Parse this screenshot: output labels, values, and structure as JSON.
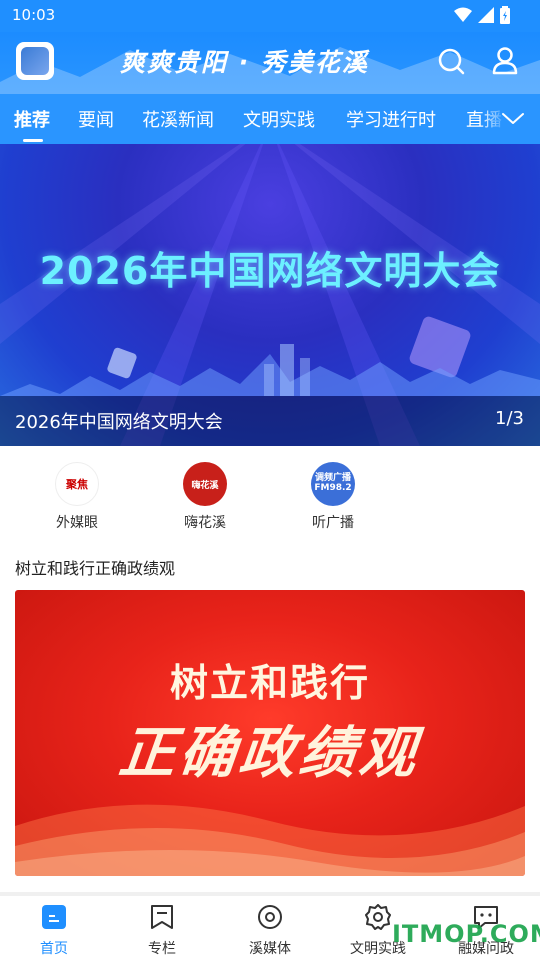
{
  "status_bar": {
    "time": "10:03",
    "icons": [
      "wifi-icon",
      "signal-icon",
      "battery-icon"
    ]
  },
  "header": {
    "slogan": "爽爽贵阳 · 秀美花溪",
    "icons": [
      "search-icon",
      "user-icon"
    ]
  },
  "tabs": {
    "items": [
      {
        "label": "推荐",
        "active": true
      },
      {
        "label": "要闻"
      },
      {
        "label": "花溪新闻"
      },
      {
        "label": "文明实践"
      },
      {
        "label": "学习进行时"
      },
      {
        "label": "直播"
      }
    ],
    "more_icon": "chevron-down-icon"
  },
  "banner": {
    "headline": "2026年中国网络文明大会",
    "caption": "2026年中国网络文明大会",
    "page": "1/3"
  },
  "quick_entries": [
    {
      "label": "外媒眼",
      "logo_text": "聚焦"
    },
    {
      "label": "嗨花溪",
      "logo_text": "嗨花溪"
    },
    {
      "label": "听广播",
      "logo_text": "调频广播 FM98.2"
    }
  ],
  "article": {
    "title": "树立和践行正确政绩观",
    "image_line1": "树立和践行",
    "image_line2": "正确政绩观"
  },
  "bottom_nav": [
    {
      "label": "首页",
      "icon": "home-icon",
      "active": true
    },
    {
      "label": "专栏",
      "icon": "bookmark-icon"
    },
    {
      "label": "溪媒体",
      "icon": "media-icon"
    },
    {
      "label": "文明实践",
      "icon": "gear-icon"
    },
    {
      "label": "融媒问政",
      "icon": "chat-icon"
    }
  ],
  "watermark": "ITMOP.COM",
  "colors": {
    "brand": "#1f8fff",
    "banner": "#2a2fc0",
    "article_red": "#e8231a",
    "watermark": "#18a34a"
  }
}
